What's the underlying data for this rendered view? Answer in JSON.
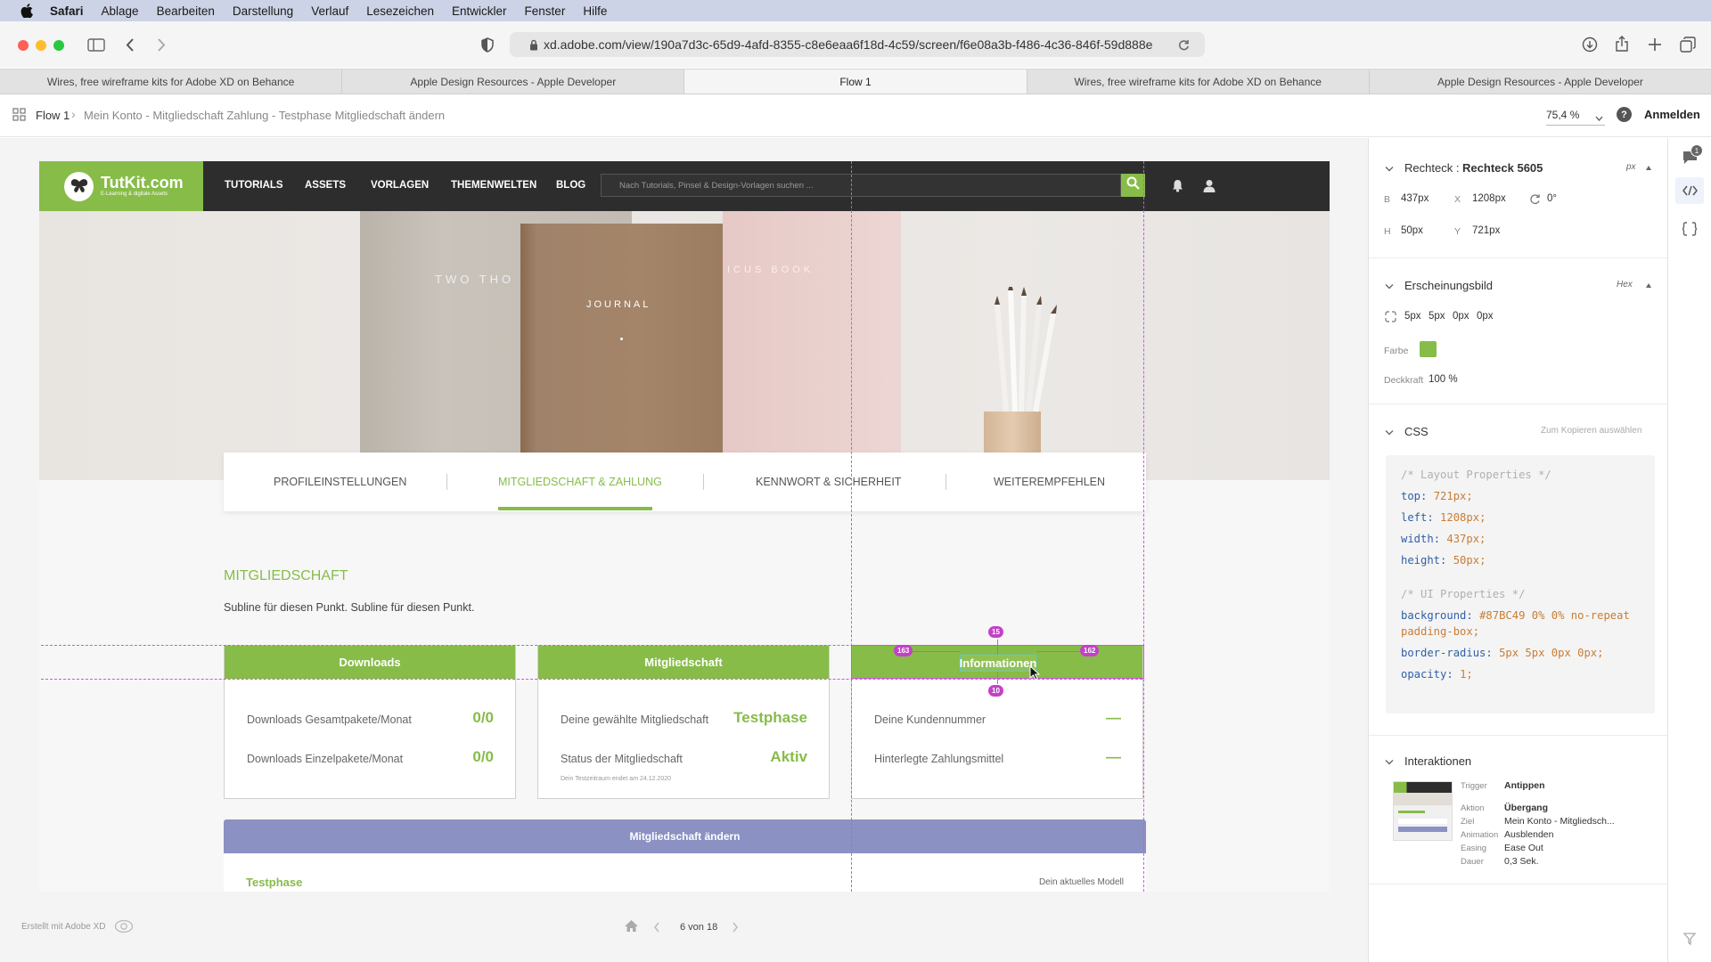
{
  "menubar": {
    "apple_icon": "apple-logo-icon",
    "items": [
      "Safari",
      "Ablage",
      "Bearbeiten",
      "Darstellung",
      "Verlauf",
      "Lesezeichen",
      "Entwickler",
      "Fenster",
      "Hilfe"
    ]
  },
  "toolbar": {
    "url": "xd.adobe.com/view/190a7d3c-65d9-4afd-8355-c8e6eaa6f18d-4c59/screen/f6e08a3b-f486-4c36-846f-59d888e"
  },
  "browser_tabs": [
    {
      "label": "Wires, free wireframe kits for Adobe XD on Behance",
      "active": false
    },
    {
      "label": "Apple Design Resources - Apple Developer",
      "active": false
    },
    {
      "label": "Flow 1",
      "active": true
    },
    {
      "label": "Wires, free wireframe kits for Adobe XD on Behance",
      "active": false
    },
    {
      "label": "Apple Design Resources - Apple Developer",
      "active": false
    }
  ],
  "xdbar": {
    "breadcrumb_root": "Flow 1",
    "breadcrumb_page": "Mein Konto - Mitgliedschaft Zahlung - Testphase Mitgliedschaft ändern",
    "zoom": "75,4 %",
    "signin": "Anmelden"
  },
  "site": {
    "logo_name": "TutKit.com",
    "logo_sub": "E-Learning & digitale Assets",
    "nav": [
      "TUTORIALS",
      "ASSETS",
      "VORLAGEN",
      "THEMENWELTEN",
      "BLOG"
    ],
    "search_placeholder": "Nach Tutorials, Pinsel & Design-Vorlagen suchen ...",
    "hero_book1": "TWO THO AND TW",
    "hero_book2": "JOURNAL",
    "hero_book3": "ICUS BOOK",
    "profile_tabs": [
      "PROFILEINSTELLUNGEN",
      "MITGLIEDSCHAFT & ZAHLUNG",
      "KENNWORT & SICHERHEIT",
      "WEITEREMPFEHLEN"
    ],
    "active_profile_tab": 1,
    "section_title": "MITGLIEDSCHAFT",
    "section_sub": "Subline für diesen Punkt. Subline für diesen Punkt.",
    "cards": [
      {
        "title": "Downloads",
        "rows": [
          {
            "label": "Downloads Gesamtpakete/Monat",
            "value": "0/0"
          },
          {
            "label": "Downloads Einzelpakete/Monat",
            "value": "0/0"
          }
        ],
        "note": ""
      },
      {
        "title": "Mitgliedschaft",
        "rows": [
          {
            "label": "Deine gewählte Mitgliedschaft",
            "value": "Testphase"
          },
          {
            "label": "Status der Mitgliedschaft",
            "value": "Aktiv"
          }
        ],
        "note": "Dein Testzeitraum endet am 24.12.2020"
      },
      {
        "title": "Informationen",
        "rows": [
          {
            "label": "Deine Kundennummer",
            "value": "—"
          },
          {
            "label": "Hinterlegte Zahlungsmittel",
            "value": "—"
          }
        ],
        "note": ""
      }
    ],
    "change_bar": "Mitgliedschaft ändern",
    "change_left": "Testphase",
    "change_right": "Dein aktuelles Modell"
  },
  "measure": {
    "top": "15",
    "left": "163",
    "right": "162",
    "bottom": "10"
  },
  "inspector": {
    "object_type": "Rechteck",
    "object_name": "Rechteck 5605",
    "unit": "px",
    "b_label": "B",
    "b_value": "437px",
    "x_label": "X",
    "x_value": "1208px",
    "rot_value": "0°",
    "h_label": "H",
    "h_value": "50px",
    "y_label": "Y",
    "y_value": "721px",
    "appearance_title": "Erscheinungsbild",
    "hex_label": "Hex",
    "radius_values": [
      "5px",
      "5px",
      "0px",
      "0px"
    ],
    "color_label": "Farbe",
    "color": "#87BC49",
    "opacity_label": "Deckkraft",
    "opacity_value": "100 %",
    "css_title": "CSS",
    "css_copy": "Zum Kopieren auswählen",
    "css_lines": [
      {
        "text": "/* Layout Properties */",
        "kind": "comment"
      },
      {
        "prop": "top",
        "value": "721px;"
      },
      {
        "prop": "left",
        "value": "1208px;"
      },
      {
        "prop": "width",
        "value": "437px;"
      },
      {
        "prop": "height",
        "value": "50px;"
      },
      {
        "text": "/* UI Properties */",
        "kind": "comment"
      },
      {
        "prop": "background",
        "value": "#87BC49 0% 0% no-repeat padding-box;"
      },
      {
        "prop": "border-radius",
        "value": "5px 5px 0px 0px;"
      },
      {
        "prop": "opacity",
        "value": "1;"
      }
    ],
    "interactions_title": "Interaktionen",
    "interaction": [
      {
        "label": "Trigger",
        "value": "Antippen"
      },
      {
        "label": "Aktion",
        "value": "Übergang"
      },
      {
        "label": "Ziel",
        "value": "Mein Konto - Mitgliedsch..."
      },
      {
        "label": "Animation",
        "value": "Ausblenden"
      },
      {
        "label": "Easing",
        "value": "Ease Out"
      },
      {
        "label": "Dauer",
        "value": "0,3 Sek."
      }
    ],
    "comment_count": "1"
  },
  "footer": {
    "made_with": "Erstellt mit Adobe XD",
    "page_counter": "6 von 18"
  },
  "colors": {
    "accent": "#87BC49",
    "nav_dark": "#2D2D2D",
    "purple_bar": "#8B91C2",
    "guide": "#C95BD0"
  }
}
